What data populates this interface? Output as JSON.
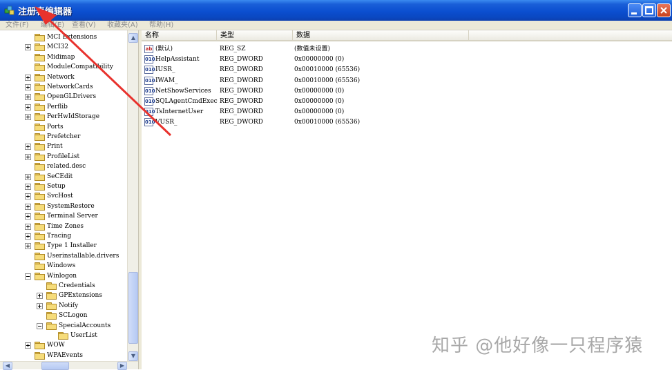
{
  "window": {
    "title": "注册表编辑器",
    "buttons": [
      "minimize-icon",
      "maximize-icon",
      "close-icon"
    ]
  },
  "menu": {
    "items": [
      "文件(F)",
      "编辑(E)",
      "查看(V)",
      "收藏夹(A)",
      "帮助(H)"
    ]
  },
  "tree": {
    "items": [
      {
        "label": "MCI Extensions",
        "indent": 1,
        "expander": "none"
      },
      {
        "label": "MCI32",
        "indent": 1,
        "expander": "plus"
      },
      {
        "label": "Midimap",
        "indent": 1,
        "expander": "none"
      },
      {
        "label": "ModuleCompatibility",
        "indent": 1,
        "expander": "none"
      },
      {
        "label": "Network",
        "indent": 1,
        "expander": "plus"
      },
      {
        "label": "NetworkCards",
        "indent": 1,
        "expander": "plus"
      },
      {
        "label": "OpenGLDrivers",
        "indent": 1,
        "expander": "plus"
      },
      {
        "label": "Perflib",
        "indent": 1,
        "expander": "plus"
      },
      {
        "label": "PerHwIdStorage",
        "indent": 1,
        "expander": "plus"
      },
      {
        "label": "Ports",
        "indent": 1,
        "expander": "none"
      },
      {
        "label": "Prefetcher",
        "indent": 1,
        "expander": "none"
      },
      {
        "label": "Print",
        "indent": 1,
        "expander": "plus"
      },
      {
        "label": "ProfileList",
        "indent": 1,
        "expander": "plus"
      },
      {
        "label": "related.desc",
        "indent": 1,
        "expander": "none"
      },
      {
        "label": "SeCEdit",
        "indent": 1,
        "expander": "plus"
      },
      {
        "label": "Setup",
        "indent": 1,
        "expander": "plus"
      },
      {
        "label": "SvcHost",
        "indent": 1,
        "expander": "plus"
      },
      {
        "label": "SystemRestore",
        "indent": 1,
        "expander": "plus"
      },
      {
        "label": "Terminal Server",
        "indent": 1,
        "expander": "plus"
      },
      {
        "label": "Time Zones",
        "indent": 1,
        "expander": "plus"
      },
      {
        "label": "Tracing",
        "indent": 1,
        "expander": "plus"
      },
      {
        "label": "Type 1 Installer",
        "indent": 1,
        "expander": "plus"
      },
      {
        "label": "Userinstallable.drivers",
        "indent": 1,
        "expander": "none"
      },
      {
        "label": "Windows",
        "indent": 1,
        "expander": "none"
      },
      {
        "label": "Winlogon",
        "indent": 1,
        "expander": "minus"
      },
      {
        "label": "Credentials",
        "indent": 2,
        "expander": "none"
      },
      {
        "label": "GPExtensions",
        "indent": 2,
        "expander": "plus"
      },
      {
        "label": "Notify",
        "indent": 2,
        "expander": "plus"
      },
      {
        "label": "SCLogon",
        "indent": 2,
        "expander": "none"
      },
      {
        "label": "SpecialAccounts",
        "indent": 2,
        "expander": "minus"
      },
      {
        "label": "UserList",
        "indent": 3,
        "expander": "none"
      },
      {
        "label": "WOW",
        "indent": 1,
        "expander": "plus"
      },
      {
        "label": "WPAEvents",
        "indent": 1,
        "expander": "none"
      }
    ]
  },
  "list": {
    "columns": [
      "名称",
      "类型",
      "数据"
    ],
    "rows": [
      {
        "icon": "string-value-icon",
        "icon_text": "ab",
        "name": "(默认)",
        "type": "REG_SZ",
        "data": "(数值未设置)"
      },
      {
        "icon": "dword-value-icon",
        "icon_text": "010",
        "name": "HelpAssistant",
        "type": "REG_DWORD",
        "data": "0x00000000 (0)"
      },
      {
        "icon": "dword-value-icon",
        "icon_text": "010",
        "name": "IUSR_",
        "type": "REG_DWORD",
        "data": "0x00010000 (65536)"
      },
      {
        "icon": "dword-value-icon",
        "icon_text": "010",
        "name": "IWAM_",
        "type": "REG_DWORD",
        "data": "0x00010000 (65536)"
      },
      {
        "icon": "dword-value-icon",
        "icon_text": "010",
        "name": "NetShowServices",
        "type": "REG_DWORD",
        "data": "0x00000000 (0)"
      },
      {
        "icon": "dword-value-icon",
        "icon_text": "010",
        "name": "SQLAgentCmdExec",
        "type": "REG_DWORD",
        "data": "0x00000000 (0)"
      },
      {
        "icon": "dword-value-icon",
        "icon_text": "010",
        "name": "TsInternetUser",
        "type": "REG_DWORD",
        "data": "0x00000000 (0)"
      },
      {
        "icon": "dword-value-icon",
        "icon_text": "010",
        "name": "VUSR_",
        "type": "REG_DWORD",
        "data": "0x00010000 (65536)"
      }
    ]
  },
  "watermark": "知乎 @他好像一只程序猿",
  "colors": {
    "title_bar": "#0b4fd0",
    "menu_bg": "#ece9d8",
    "folder": "#f6dc7a",
    "annotation_arrow": "#e8322d"
  }
}
